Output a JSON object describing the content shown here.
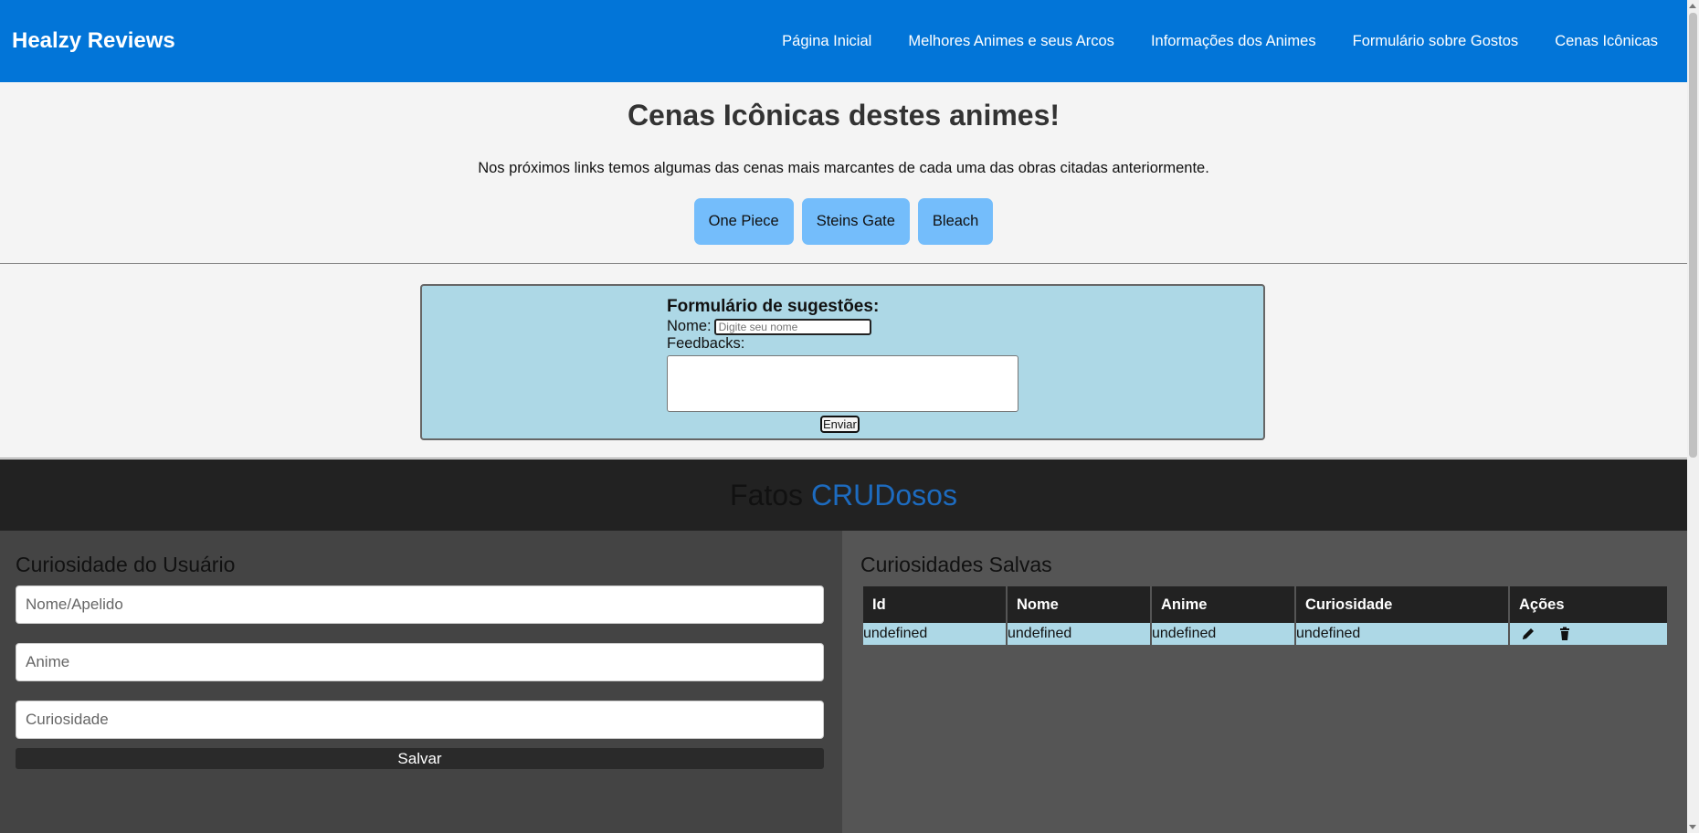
{
  "header": {
    "brand": "Healzy Reviews",
    "nav": [
      {
        "label": "Página Inicial"
      },
      {
        "label": "Melhores Animes e seus Arcos"
      },
      {
        "label": "Informações dos Animes"
      },
      {
        "label": "Formulário sobre Gostos"
      },
      {
        "label": "Cenas Icônicas"
      }
    ]
  },
  "intro": {
    "title": "Cenas Icônicas destes animes!",
    "description": "Nos próximos links temos algumas das cenas mais marcantes de cada uma das obras citadas anteriormente.",
    "buttons": [
      {
        "label": "One Piece"
      },
      {
        "label": "Steins Gate"
      },
      {
        "label": "Bleach"
      }
    ]
  },
  "suggestion_form": {
    "title": "Formulário de sugestões:",
    "name_label": "Nome:",
    "name_placeholder": "Digite seu nome",
    "feedback_label": "Feedbacks:",
    "submit_label": "Enviar"
  },
  "crud": {
    "title_prefix": "Fatos ",
    "title_accent": "CRUDosos",
    "accent_color": "#1d6bbf"
  },
  "user_form": {
    "title": "Curiosidade do Usuário",
    "fields": [
      {
        "placeholder": "Nome/Apelido"
      },
      {
        "placeholder": "Anime"
      },
      {
        "placeholder": "Curiosidade"
      }
    ],
    "save_label": "Salvar"
  },
  "saved": {
    "title": "Curiosidades Salvas",
    "columns": [
      "Id",
      "Nome",
      "Anime",
      "Curiosidade",
      "Ações"
    ],
    "rows": [
      {
        "id": "undefined",
        "nome": "undefined",
        "anime": "undefined",
        "curiosidade": "undefined"
      }
    ],
    "action_icons": [
      "edit-icon",
      "trash-icon"
    ]
  },
  "colors": {
    "header_bg": "#0275d8",
    "scene_button_bg": "#74bdfb",
    "form_bg": "#add8e6"
  }
}
